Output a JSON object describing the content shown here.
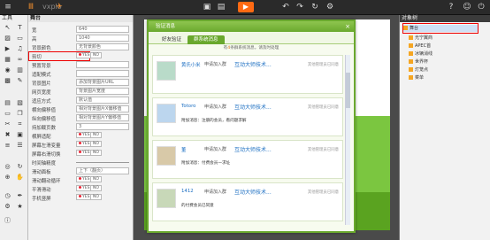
{
  "app": {
    "logo": "vxplo",
    "play_symbol": "▶",
    "colors": {
      "accent": "#ff6a13",
      "dialog_green": "#6aa92e"
    }
  },
  "toolbar": {
    "icons": [
      "logo-icon",
      "rocket-icon",
      "save-icon",
      "save-as-icon",
      "play-icon",
      "undo-icon",
      "redo-icon",
      "refresh-icon",
      "settings-icon",
      "help-icon",
      "user-icon",
      "power-icon"
    ]
  },
  "tools": {
    "title": "工具"
  },
  "props": {
    "title": "舞台",
    "rows": [
      {
        "label": "宽",
        "value": "640"
      },
      {
        "label": "高",
        "value": "1040"
      },
      {
        "label": "背景颜色",
        "value": "无背景颜色"
      },
      {
        "label": "剪切",
        "yes": "YES",
        "no": "NO"
      },
      {
        "label": "预置背景",
        "value": ""
      },
      {
        "label": "适配模式",
        "value": ""
      },
      {
        "label": "背景图片",
        "value": "添加背景图片URL"
      },
      {
        "label": "网页宽度",
        "value": "背景图片宽度"
      },
      {
        "label": "适应方式",
        "value": "默认值"
      },
      {
        "label": "横向偏移值",
        "value": "相对背景图片X偏移值"
      },
      {
        "label": "纵向偏移值",
        "value": "相对背景图片Y偏移值"
      },
      {
        "label": "持加载页数",
        "value": "3"
      },
      {
        "label": "横屏适配",
        "yes": "YES",
        "no": "NO"
      },
      {
        "label": "屏幕左滑变量",
        "yes": "YES",
        "no": "NO"
      },
      {
        "label": "屏幕右滑切换",
        "yes": "YES",
        "no": "NO"
      },
      {
        "label": "时间轴精度",
        "value": ""
      },
      {
        "label": "滑动面板",
        "value": "上下（翻页）"
      },
      {
        "label": "滑动翻动循环",
        "yes": "YES",
        "no": "NO"
      },
      {
        "label": "平滑滑动",
        "yes": "YES",
        "no": "NO"
      },
      {
        "label": "手机竖屏",
        "yes": "YES",
        "no": "NO"
      }
    ]
  },
  "dialog": {
    "title": "验证消息",
    "close": "×",
    "tabs": [
      "好友验证",
      "群系统消息"
    ],
    "notice_prefix": "有",
    "notice_count": "4",
    "notice_suffix": "条群系统消息，请及时处理",
    "items": [
      {
        "name": "黄氏小米",
        "action": "申请加入群",
        "group": "互动大师技术...",
        "note_label": "",
        "note": "",
        "status": "其他管理员已同意"
      },
      {
        "name": "Totoro",
        "action": "申请加入群",
        "group": "互动大师技术...",
        "note_label": "附加消息：",
        "note": "注册的会员，看问题求解",
        "status": "其他管理员已同意"
      },
      {
        "name": "董",
        "action": "申请加入群",
        "group": "互动大师技术...",
        "note_label": "附加消息：",
        "note": "付费会员一求址",
        "status": "其他管理员已同意"
      },
      {
        "name": "1412",
        "action": "申请加入群",
        "group": "互动大师技术...",
        "note_label": "",
        "note": "的付费会员已同意",
        "status": "其他管理员已同意"
      }
    ]
  },
  "objects": {
    "title": "对象树",
    "items": [
      "舞台",
      "光宁翼商",
      "APEC首",
      "冰辆消线",
      "世界杯",
      "灯笼点",
      "菜单"
    ]
  }
}
